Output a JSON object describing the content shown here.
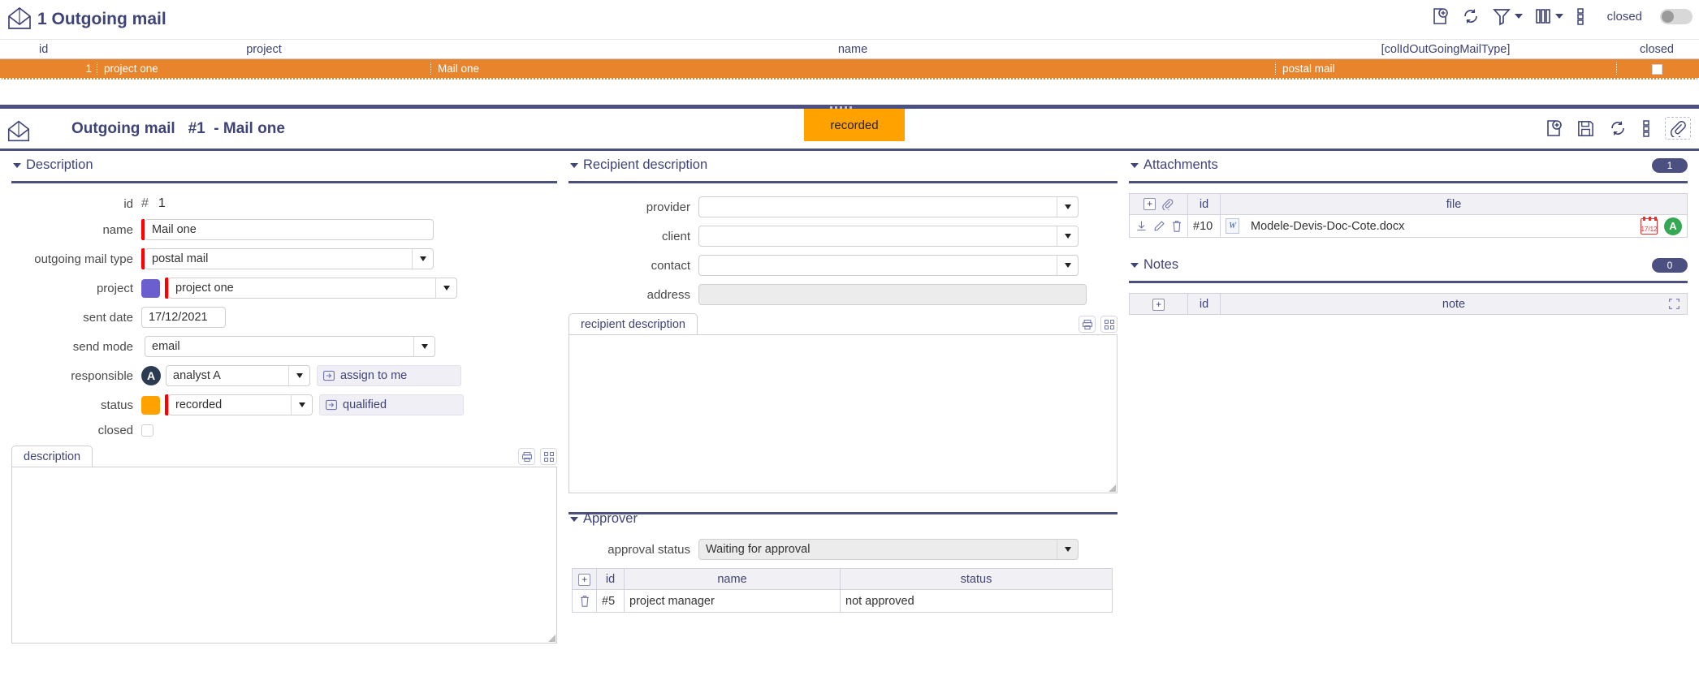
{
  "top": {
    "title": "1 Outgoing mail",
    "icon": "envelope-open-icon",
    "tools": [
      {
        "name": "add-document-icon",
        "label": ""
      },
      {
        "name": "refresh-icon",
        "label": ""
      },
      {
        "name": "filter-icon",
        "label": ""
      },
      {
        "name": "columns-icon",
        "label": ""
      },
      {
        "name": "more-options-icon",
        "label": ""
      }
    ],
    "closed_label": "closed",
    "closed_toggle": "off"
  },
  "grid": {
    "columns": [
      "id",
      "project",
      "name",
      "[colIdOutGoingMailType]",
      "closed"
    ],
    "rows": [
      {
        "id": "1",
        "project": "project one",
        "name": "Mail one",
        "type": "postal mail",
        "closed": false
      }
    ],
    "row_color": "#e8842c"
  },
  "detail": {
    "icon": "envelope-open-icon",
    "entity": "Outgoing mail",
    "record_number": "#1",
    "dash": "-",
    "record_name": "Mail one",
    "status_badge": "recorded",
    "status_badge_color": "#ffa200",
    "tools": [
      {
        "name": "new-document-icon"
      },
      {
        "name": "save-icon"
      },
      {
        "name": "refresh-icon"
      },
      {
        "name": "more-options-icon"
      },
      {
        "name": "attachment-clip-icon"
      }
    ]
  },
  "description_panel": {
    "title": "Description",
    "fields": {
      "id_label": "id",
      "id_hash": "#",
      "id_value": "1",
      "name_label": "name",
      "name_value": "Mail one",
      "type_label": "outgoing mail type",
      "type_value": "postal mail",
      "project_label": "project",
      "project_value": "project one",
      "project_color": "#6b5fd0",
      "sent_date_label": "sent date",
      "sent_date_value": "17/12/2021",
      "send_mode_label": "send mode",
      "send_mode_value": "email",
      "responsible_label": "responsible",
      "responsible_value": "analyst A",
      "responsible_initial": "A",
      "assign_button": "assign to me",
      "status_label": "status",
      "status_value": "recorded",
      "status_color": "#ffa200",
      "qualified_button": "qualified",
      "closed_label": "closed",
      "closed_value": false
    },
    "tab_label": "description",
    "tab_icons": [
      "print-icon",
      "expand-icon"
    ],
    "textarea_value": ""
  },
  "recipient_panel": {
    "title": "Recipient description",
    "fields": {
      "provider_label": "provider",
      "provider_value": "",
      "client_label": "client",
      "client_value": "",
      "contact_label": "contact",
      "contact_value": "",
      "address_label": "address",
      "address_value": ""
    },
    "tab_label": "recipient description",
    "tab_icons": [
      "print-icon",
      "expand-icon"
    ],
    "textarea_value": ""
  },
  "approver_panel": {
    "title": "Approver",
    "approval_status_label": "approval status",
    "approval_status_value": "Waiting for approval",
    "columns": [
      "id",
      "name",
      "status"
    ],
    "rows": [
      {
        "id": "#5",
        "name": "project manager",
        "status": "not approved"
      }
    ]
  },
  "attachments_panel": {
    "title": "Attachments",
    "count": "1",
    "columns": [
      "id",
      "file"
    ],
    "rows": [
      {
        "id": "#10",
        "file": "Modele-Devis-Doc-Cote.docx",
        "file_type_icon": "word-doc-icon",
        "date_badge": "17/12",
        "avatar_initial": "A",
        "avatar_color": "#34a853",
        "row_icons": [
          "download-icon",
          "edit-icon",
          "delete-icon"
        ]
      }
    ],
    "header_icons": [
      "add-icon",
      "paperclip-icon"
    ]
  },
  "notes_panel": {
    "title": "Notes",
    "count": "0",
    "columns": [
      "id",
      "note"
    ],
    "rows": [],
    "header_icons": [
      "add-icon"
    ],
    "expand_icon": "expand-icon"
  }
}
